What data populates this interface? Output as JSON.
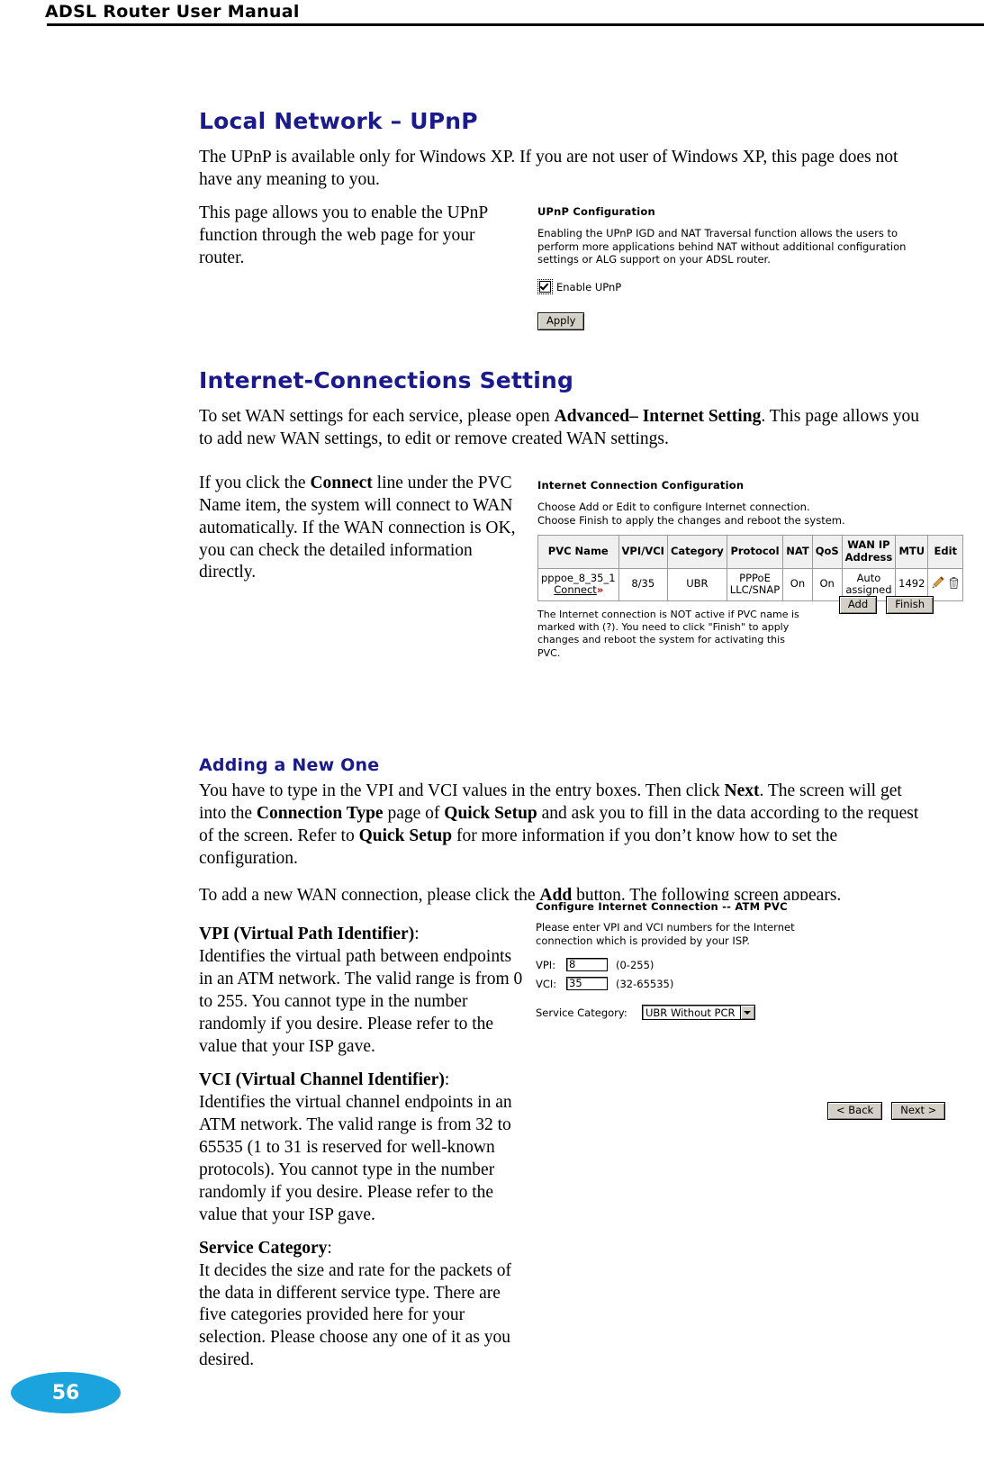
{
  "header": {
    "title": "ADSL Router User Manual"
  },
  "upnp": {
    "heading": "Local Network –  UPnP",
    "paragraph1": "The UPnP is available only for Windows XP. If you are not user of Windows XP, this page does not have any meaning to you.",
    "paragraph2": "This page allows you to enable the UPnP function through the web page for your router.",
    "screen": {
      "title": "UPnP Configuration",
      "description": "Enabling the UPnP IGD and NAT Traversal function allows the users to perform more applications behind NAT without additional configuration settings or ALG support on your ADSL router.",
      "checkbox_label": "Enable UPnP",
      "checkbox_checked": true,
      "apply_label": "Apply"
    }
  },
  "internet_connections": {
    "heading": "Internet-Connections Setting",
    "paragraph1_part1": "To set WAN settings for each service, please open ",
    "paragraph1_bold": "Advanced– Internet Setting",
    "paragraph1_part2": ". This page allows you to add new WAN settings, to edit or remove created WAN settings.",
    "paragraph2_part1": "If you click the ",
    "paragraph2_bold": "Connect",
    "paragraph2_part2": " line under the PVC Name item, the system will connect to WAN automatically. If the WAN connection is OK, you can check the detailed information directly.",
    "screen": {
      "title": "Internet Connection Configuration",
      "instruction_line1": "Choose Add or Edit to configure Internet connection.",
      "instruction_line2": "Choose Finish to apply the changes and reboot the system.",
      "table": {
        "headers": [
          "PVC Name",
          "VPI/VCI",
          "Category",
          "Protocol",
          "NAT",
          "QoS",
          "WAN IP Address",
          "MTU",
          "Edit"
        ],
        "rows": [
          {
            "pvc_name": "pppoe_8_35_1",
            "connect_label": "Connect",
            "vpi_vci": "8/35",
            "category": "UBR",
            "protocol": "PPPoE LLC/SNAP",
            "nat": "On",
            "qos": "On",
            "wan_ip": "Auto assigned",
            "mtu": "1492"
          }
        ]
      },
      "note": "The Internet connection is NOT active if PVC name is marked with (?). You need to click \"Finish\" to apply changes and reboot the system for activating this PVC.",
      "add_label": "Add",
      "finish_label": "Finish"
    }
  },
  "adding_new": {
    "heading": "Adding a New One",
    "paragraph1_part1": "You have to type in the VPI and VCI values in the entry boxes. Then click ",
    "paragraph1_b1": "Next",
    "paragraph1_part2": ". The screen will get into the ",
    "paragraph1_b2": "Connection Type",
    "paragraph1_part3": " page of ",
    "paragraph1_b3": "Quick Setup",
    "paragraph1_part4": " and ask you to fill in the data according to the request of the screen. Refer to ",
    "paragraph1_b4": "Quick Setup",
    "paragraph1_part5": " for more information if you don’t know how to set the configuration.",
    "paragraph2_part1": "To add a new WAN connection, please click the ",
    "paragraph2_bold": "Add",
    "paragraph2_part2": " button. The following screen appears.",
    "definitions": [
      {
        "term": "VPI (Virtual Path Identifier)",
        "text": ":\nIdentifies the virtual path between endpoints in an ATM network. The valid range is from 0 to 255. You cannot type in the number randomly if you desire. Please refer to the value that your ISP gave."
      },
      {
        "term": "VCI (Virtual Channel Identifier)",
        "text": ":\nIdentifies the virtual channel endpoints in an ATM network. The valid range is from 32 to 65535 (1 to 31 is reserved for well-known protocols). You cannot type in the number randomly if you desire. Please refer to the value that your ISP gave."
      },
      {
        "term": "Service Category",
        "text": ":\nIt decides the size and rate for the packets of the data in different service type. There are five categories provided here for your selection. Please choose any one of it as you desired."
      }
    ],
    "screen": {
      "title_normal": "Configure Internet Connection -- ",
      "title_bold": "ATM PVC",
      "title_full": "Configure Internet Connection -- ATM PVC",
      "description": "Please enter VPI and VCI numbers for the Internet connection which is provided by your ISP.",
      "vpi_label": "VPI:",
      "vpi_value": "8",
      "vpi_hint": "(0-255)",
      "vci_label": "VCI:",
      "vci_value": "35",
      "vci_hint": "(32-65535)",
      "service_category_label": "Service Category:",
      "service_category_value": "UBR Without PCR",
      "back_label": "< Back",
      "next_label": "Next >"
    }
  },
  "footer": {
    "page_number": "56"
  },
  "colors": {
    "heading": "#1a1a8c",
    "page_badge": "#1ba3dd",
    "chrome_face": "#d4d0c8"
  }
}
